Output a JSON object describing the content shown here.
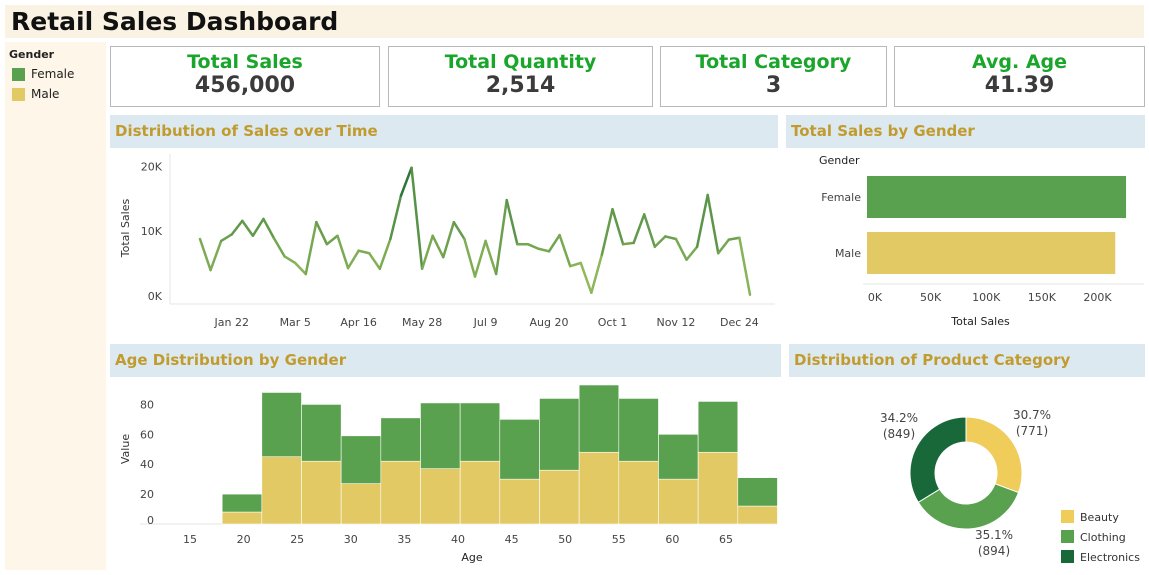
{
  "dashboard": {
    "title": "Retail Sales Dashboard"
  },
  "legend": {
    "title": "Gender",
    "items": [
      {
        "label": "Female",
        "color": "#59a14f"
      },
      {
        "label": "Male",
        "color": "#e2c964"
      }
    ]
  },
  "kpis": [
    {
      "label": "Total Sales",
      "value": "456,000"
    },
    {
      "label": "Total Quantity",
      "value": "2,514"
    },
    {
      "label": "Total Category",
      "value": "3"
    },
    {
      "label": "Avg. Age",
      "value": "41.39"
    }
  ],
  "sections": {
    "sales_time": "Distribution of Sales over Time",
    "sales_gender": "Total Sales by Gender",
    "age_dist": "Age Distribution by Gender",
    "product_cat": "Distribution of Product Category"
  },
  "chart_data": [
    {
      "id": "sales_time",
      "type": "line",
      "ylabel": "Total Sales",
      "xlabel": "",
      "x_ticks": [
        "Jan 22",
        "Mar 5",
        "Apr 16",
        "May 28",
        "Jul 9",
        "Aug 20",
        "Oct 1",
        "Nov 12",
        "Dec 24"
      ],
      "y_ticks": [
        "0K",
        "10K",
        "20K"
      ],
      "ylim": [
        0,
        21000
      ],
      "x_start": "2023-01-01",
      "x_step_days": 7,
      "values": [
        8800,
        4000,
        8500,
        9500,
        11600,
        9300,
        11900,
        8900,
        6100,
        5100,
        3400,
        11400,
        8000,
        9300,
        4300,
        7000,
        6600,
        4200,
        8800,
        15500,
        19800,
        4200,
        9300,
        6000,
        11400,
        8800,
        3000,
        8500,
        3400,
        14800,
        8000,
        8000,
        7300,
        6900,
        9400,
        4600,
        5100,
        500,
        6400,
        13400,
        8000,
        8200,
        12600,
        7600,
        9200,
        8800,
        5600,
        7600,
        15600,
        6600,
        8700,
        9000,
        200
      ],
      "color_low": "#9cc15f",
      "color_high": "#1e6b33"
    },
    {
      "id": "sales_gender",
      "type": "bar",
      "orientation": "horizontal",
      "row_header": "Gender",
      "categories": [
        "Female",
        "Male"
      ],
      "values": [
        232840,
        223160
      ],
      "xlabel": "Total Sales",
      "x_ticks": [
        "0K",
        "50K",
        "100K",
        "150K",
        "200K"
      ],
      "xlim": [
        0,
        240000
      ],
      "colors": [
        "#59a14f",
        "#e2c964"
      ]
    },
    {
      "id": "age_dist",
      "type": "bar",
      "stacked": true,
      "xlabel": "Age",
      "ylabel": "Value",
      "x_ticks": [
        15,
        20,
        25,
        30,
        35,
        40,
        45,
        50,
        55,
        60,
        65
      ],
      "y_ticks": [
        0,
        20,
        40,
        60,
        80
      ],
      "ylim": [
        0,
        95
      ],
      "bin_edges": [
        18,
        21.7,
        25.4,
        29.1,
        32.8,
        36.5,
        40.2,
        43.9,
        47.6,
        51.3,
        55,
        58.7,
        62.4,
        66.1,
        69.8
      ],
      "series": [
        {
          "name": "Male",
          "color": "#e2c964",
          "values": [
            8,
            45,
            42,
            27,
            42,
            37,
            42,
            30,
            36,
            48,
            42,
            30,
            48,
            12
          ]
        },
        {
          "name": "Female",
          "color": "#59a14f",
          "values": [
            12,
            43,
            38,
            32,
            29,
            44,
            39,
            40,
            48,
            45,
            42,
            30,
            34,
            19
          ]
        }
      ]
    },
    {
      "id": "product_cat",
      "type": "pie",
      "donut": true,
      "categories": [
        "Beauty",
        "Clothing",
        "Electronics"
      ],
      "values": [
        771,
        894,
        849
      ],
      "percent_labels": [
        "30.7%",
        "35.1%",
        "34.2%"
      ],
      "count_labels": [
        "(771)",
        "(894)",
        "(849)"
      ],
      "colors": [
        "#f0cc5a",
        "#59a14f",
        "#19683a"
      ]
    }
  ]
}
